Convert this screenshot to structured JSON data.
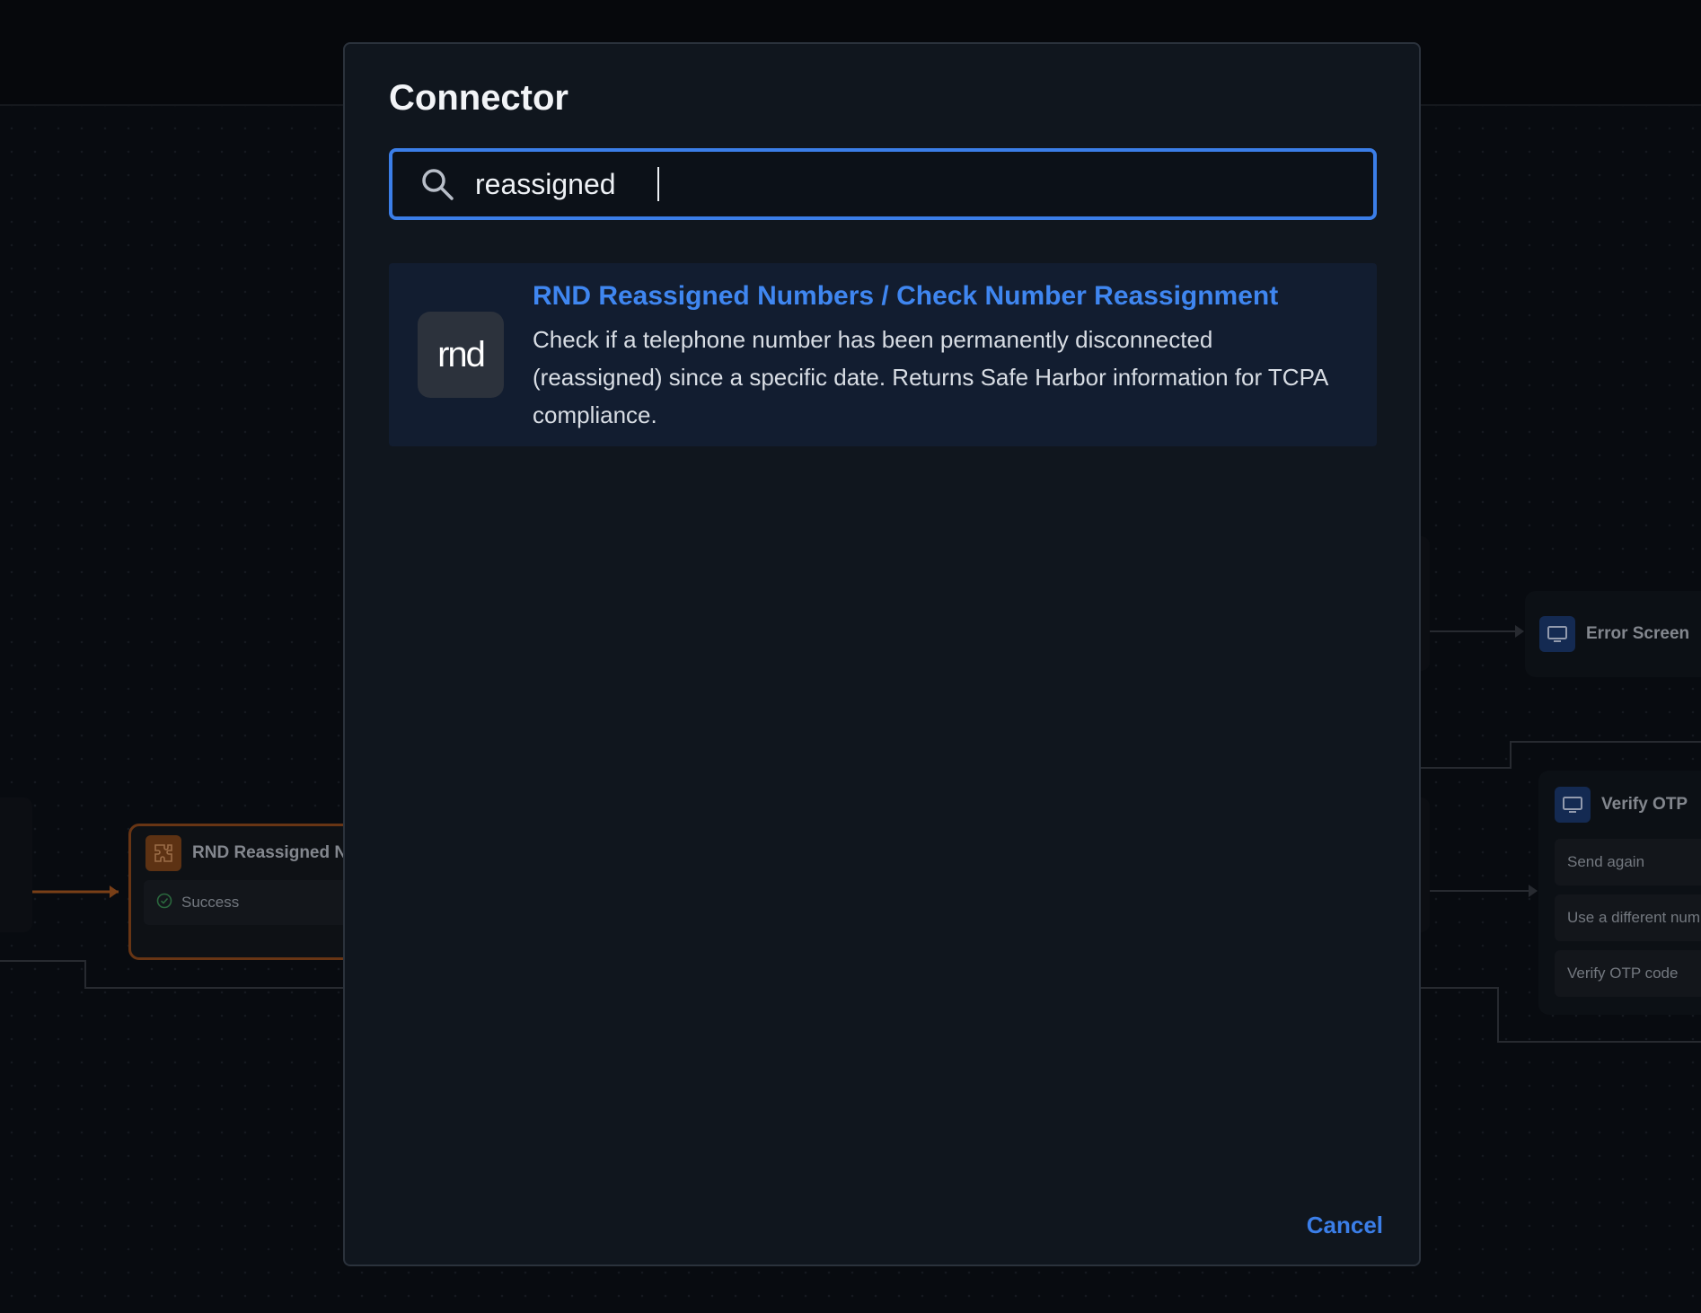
{
  "modal": {
    "title": "Connector",
    "search": {
      "value": "reassigned",
      "placeholder": ""
    },
    "results": [
      {
        "logo_text": "rnd",
        "title": "RND Reassigned Numbers / Check Number Reassignment",
        "description": "Check if a telephone number has been permanently disconnected (reassigned) since a specific date. Returns Safe Harbor information for TCPA compliance."
      }
    ],
    "cancel_label": "Cancel"
  },
  "canvas": {
    "rnd_node": {
      "title": "RND Reassigned Nu",
      "outputs": [
        "Success"
      ]
    },
    "error_node": {
      "title": "Error Screen"
    },
    "verify_node": {
      "title": "Verify OTP",
      "outputs": [
        "Send again",
        "Use a different num",
        "Verify OTP code"
      ]
    }
  },
  "colors": {
    "accent": "#3b7ee8",
    "connector_orange": "#9a4f1e",
    "modal_bg": "#10161e",
    "result_bg": "#121d30"
  }
}
